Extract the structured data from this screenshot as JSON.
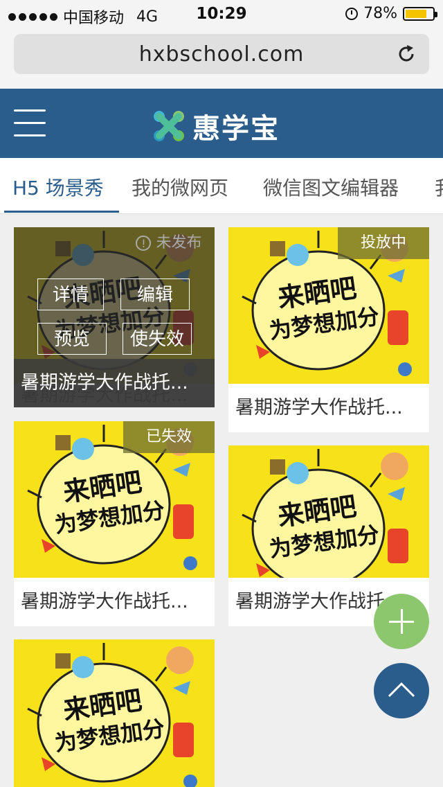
{
  "status_bar": {
    "carrier": "中国移动",
    "network": "4G",
    "time": "10:29",
    "battery": "78%",
    "battery_level": 0.78,
    "battery_color": "#f5c400"
  },
  "browser": {
    "url": "hxbschool.com",
    "reload_icon": "reload-icon"
  },
  "header": {
    "menu_icon": "hamburger-icon",
    "brand_name": "惠学宝",
    "brand_color": "#2b5d8c"
  },
  "tabs": [
    {
      "label": "H5 场景秀",
      "active": true
    },
    {
      "label": "我的微网页",
      "active": false
    },
    {
      "label": "微信图文编辑器",
      "active": false
    },
    {
      "label": "我",
      "active": false
    }
  ],
  "cards": [
    {
      "title": "暑期游学大作战托...",
      "status": "未发布",
      "status_icon": "info-circle-icon",
      "actions": [
        "详情",
        "编辑",
        "预览",
        "使失效"
      ],
      "overlay_open": true
    },
    {
      "title": "暑期游学大作战托...",
      "status": "投放中"
    },
    {
      "title": "暑期游学大作战托...",
      "status": "已失效"
    },
    {
      "title": "暑期游学大作战托...",
      "status": ""
    },
    {
      "title": "",
      "status": ""
    }
  ],
  "poster": {
    "line1": "来晒吧",
    "line2": "为梦想加分",
    "bg_color": "#f7e21a"
  },
  "fabs": {
    "add_icon": "plus-icon",
    "add_color": "#8cc76d",
    "top_icon": "chevron-up-icon",
    "top_color": "#2b5d8c"
  }
}
